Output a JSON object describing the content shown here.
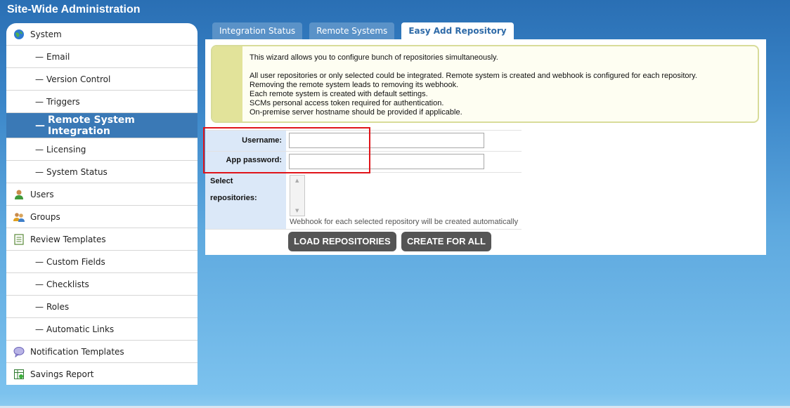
{
  "app": {
    "title": "Site-Wide Administration"
  },
  "sidebar": {
    "items": [
      {
        "label": "System",
        "icon": "globe-icon",
        "sub": false
      },
      {
        "label": "Email",
        "sub": true
      },
      {
        "label": "Version Control",
        "sub": true
      },
      {
        "label": "Triggers",
        "sub": true
      },
      {
        "label": "Remote System Integration",
        "sub": true,
        "active": true
      },
      {
        "label": "Licensing",
        "sub": true
      },
      {
        "label": "System Status",
        "sub": true
      },
      {
        "label": "Users",
        "icon": "user-icon",
        "sub": false
      },
      {
        "label": "Groups",
        "icon": "group-icon",
        "sub": false
      },
      {
        "label": "Review Templates",
        "icon": "document-icon",
        "sub": false
      },
      {
        "label": "Custom Fields",
        "sub": true
      },
      {
        "label": "Checklists",
        "sub": true
      },
      {
        "label": "Roles",
        "sub": true
      },
      {
        "label": "Automatic Links",
        "sub": true
      },
      {
        "label": "Notification Templates",
        "icon": "speech-bubble-icon",
        "sub": false
      },
      {
        "label": "Savings Report",
        "icon": "spreadsheet-icon",
        "sub": false
      }
    ]
  },
  "tabs": [
    {
      "label": "Integration Status"
    },
    {
      "label": "Remote Systems"
    },
    {
      "label": "Easy Add Repository",
      "active": true
    }
  ],
  "info": {
    "line1": "This wizard allows you to configure bunch of repositories simultaneously.",
    "line2": "All user repositories or only selected could be integrated. Remote system is created and webhook is configured for each repository.",
    "line3": "Removing the remote system leads to removing its webhook.",
    "line4": "Each remote system is created with default settings.",
    "line5": "SCMs personal access token required for authentication.",
    "line6": "On-premise server hostname should be provided if applicable."
  },
  "form": {
    "username_label": "Username:",
    "username_value": "",
    "password_label": "App password:",
    "password_value": "",
    "repos_label": "Select repositories:",
    "repos_hint": "Webhook for each selected repository will be created automatically"
  },
  "buttons": {
    "load": "LOAD REPOSITORIES",
    "create": "CREATE FOR ALL"
  },
  "colors": {
    "accent": "#3a79b6",
    "highlight": "#e0141a",
    "button": "#555555"
  }
}
